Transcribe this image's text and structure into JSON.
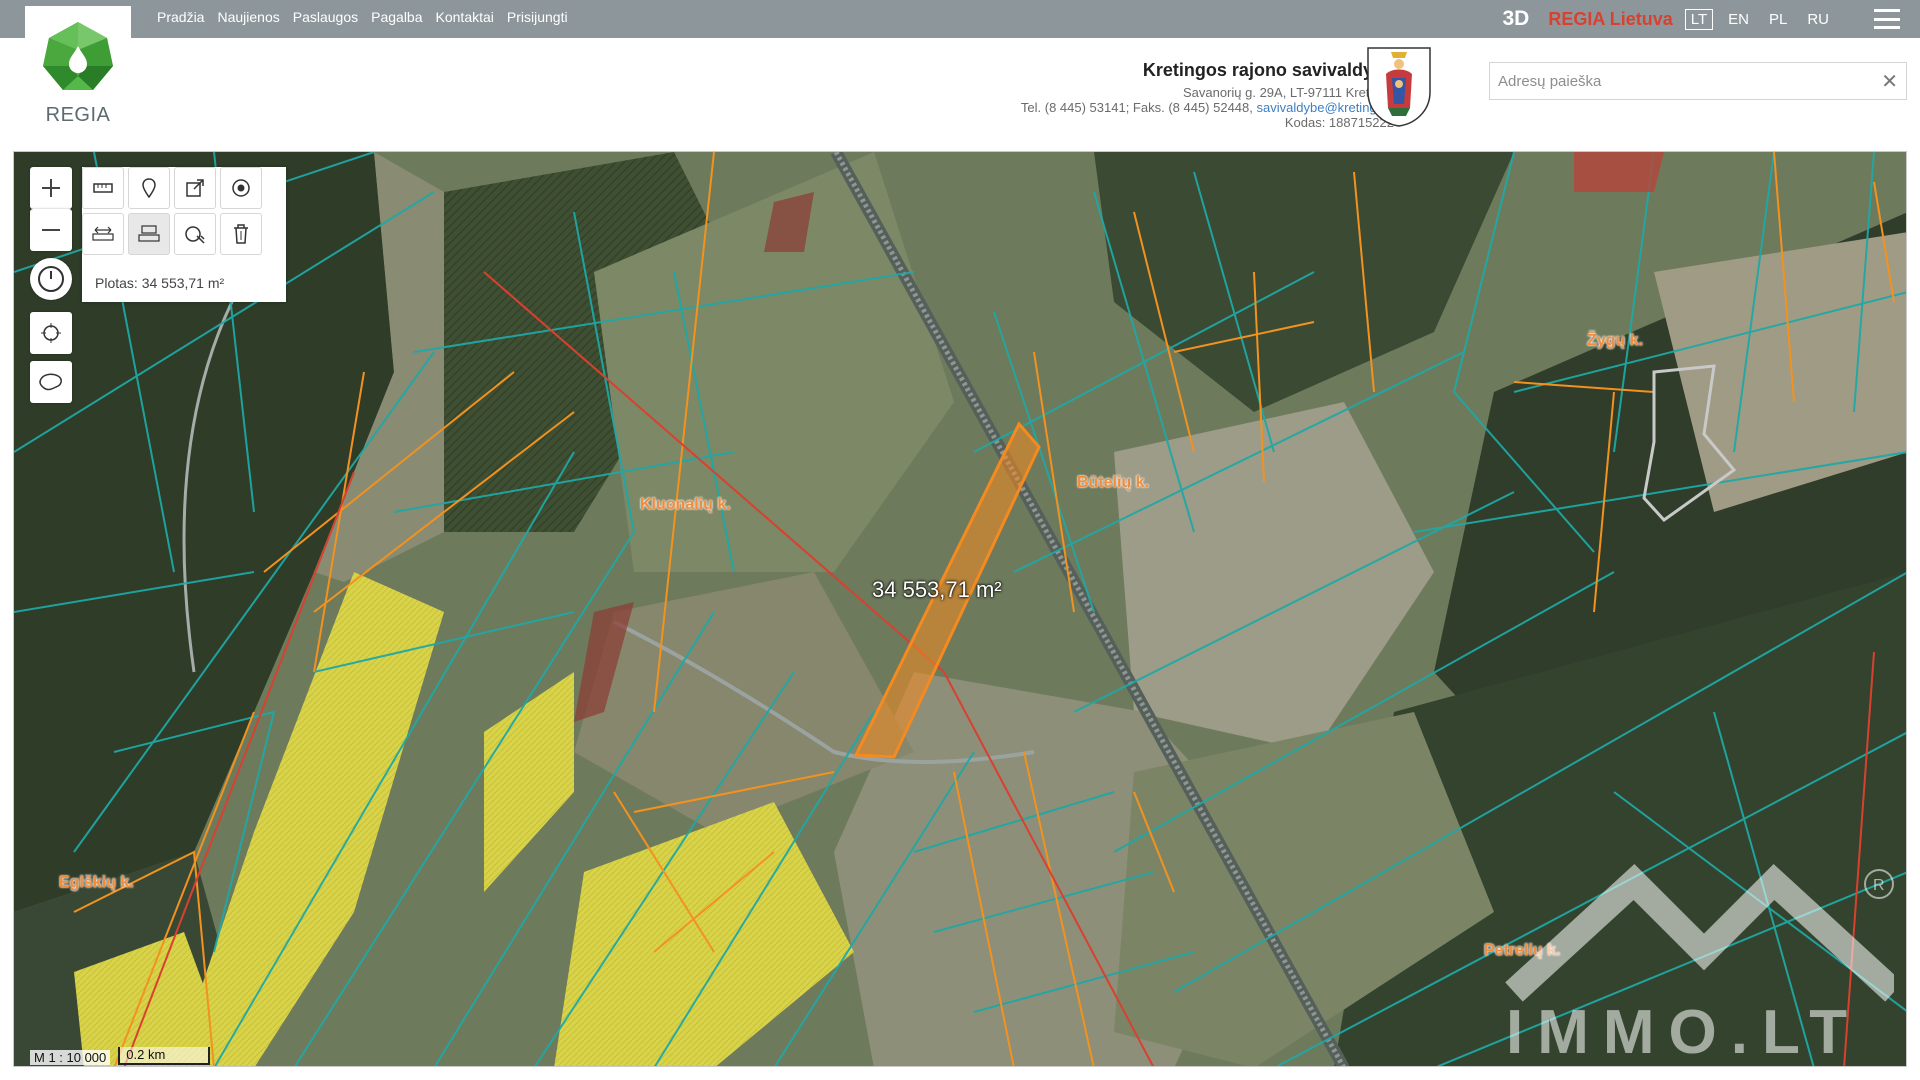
{
  "nav": {
    "items": [
      "Pradžia",
      "Naujienos",
      "Paslaugos",
      "Pagalba",
      "Kontaktai",
      "Prisijungti"
    ]
  },
  "topright": {
    "mode_3d": "3D",
    "regia_lietuva": "REGIA Lietuva",
    "languages": [
      "LT",
      "EN",
      "PL",
      "RU"
    ],
    "active_language": "LT"
  },
  "logo": {
    "text": "REGIA"
  },
  "municipality": {
    "name": "Kretingos rajono savivaldybė",
    "address": "Savanorių g. 29A, LT-97111 Kretinga",
    "phone": "Tel. (8 445) 53141; Faks. (8 445) 52448,",
    "email": "savivaldybe@kretinga.lt",
    "code": "Kodas: 188715222"
  },
  "search": {
    "placeholder": "Adresų paieška",
    "value": "",
    "clear_icon": "close-icon"
  },
  "toolbar": {
    "plotas": "Plotas: 34 553,71 m²",
    "icons": [
      "zoom-in-icon",
      "zoom-out-icon",
      "measure-icon",
      "marker-icon",
      "share-icon",
      "target-icon",
      "measure-length-icon",
      "measure-area-icon",
      "measure-clear-icon",
      "delete-icon",
      "history-icon",
      "locate-icon",
      "layers-icon"
    ]
  },
  "map": {
    "area_label": "34 553,71 m²",
    "villages": [
      "Kluonalių k.",
      "Būtelių k.",
      "Žygų k.",
      "Eglškių k.",
      "Petrelių k."
    ],
    "scale": "M 1 : 10 000",
    "scale_bar": "0.2 km"
  },
  "watermark": {
    "text": "IMMO.LT"
  },
  "colors": {
    "topbar": "#8d979b",
    "parcel_teal": "#1fa8a5",
    "parcel_orange": "#f2921f",
    "selection": "#f58a1f"
  }
}
